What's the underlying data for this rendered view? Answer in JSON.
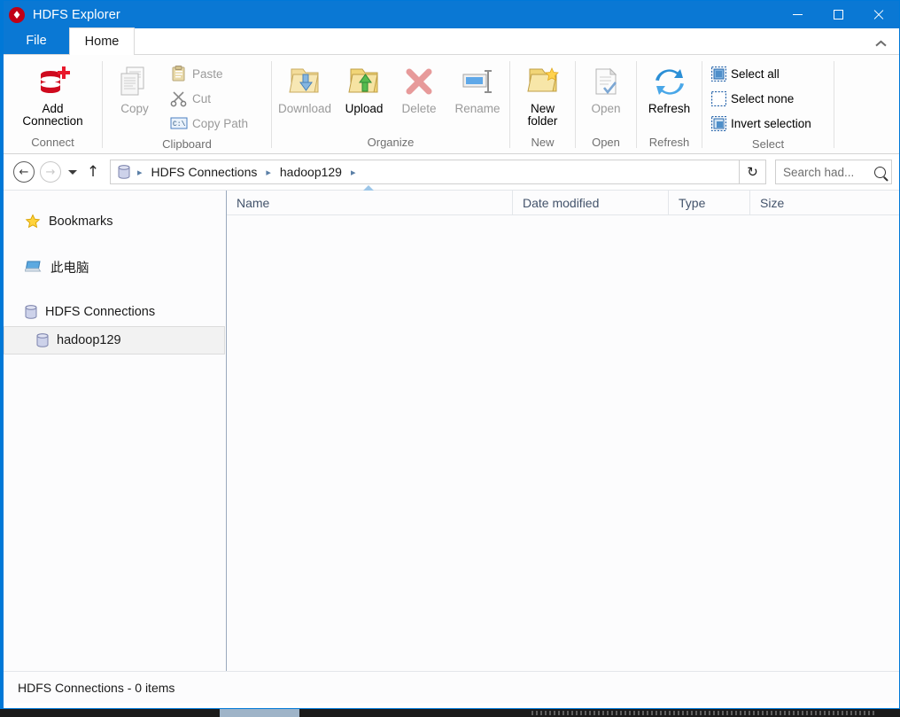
{
  "window": {
    "title": "HDFS Explorer",
    "app_icon": "hdfs-app-icon",
    "accent_color": "#0a78d4",
    "controls": {
      "minimize": "Minimize",
      "maximize": "Maximize",
      "close": "Close"
    }
  },
  "tabs": [
    {
      "label": "File",
      "id": "file",
      "active": false
    },
    {
      "label": "Home",
      "id": "home",
      "active": true
    }
  ],
  "ribbon": {
    "collapse_tooltip": "Minimize the Ribbon",
    "groups": [
      {
        "label": "Connect",
        "items": [
          {
            "label": "Add\nConnection",
            "label_line1": "Add",
            "label_line2": "Connection",
            "icon": "database-add-icon",
            "enabled": true,
            "size": "large"
          }
        ]
      },
      {
        "label": "Clipboard",
        "items": [
          {
            "label": "Copy",
            "icon": "copy-icon",
            "enabled": false,
            "size": "large"
          },
          {
            "label": "Paste",
            "icon": "paste-icon",
            "enabled": false,
            "size": "small"
          },
          {
            "label": "Cut",
            "icon": "scissors-icon",
            "enabled": false,
            "size": "small"
          },
          {
            "label": "Copy Path",
            "icon": "copy-path-icon",
            "enabled": false,
            "size": "small"
          }
        ]
      },
      {
        "label": "Organize",
        "items": [
          {
            "label": "Download",
            "icon": "folder-download-icon",
            "enabled": false,
            "size": "large"
          },
          {
            "label": "Upload",
            "icon": "folder-upload-icon",
            "enabled": true,
            "size": "large"
          },
          {
            "label": "Delete",
            "icon": "delete-x-icon",
            "enabled": false,
            "size": "large"
          },
          {
            "label": "Rename",
            "icon": "rename-icon",
            "enabled": false,
            "size": "large"
          }
        ]
      },
      {
        "label": "New",
        "items": [
          {
            "label_line1": "New",
            "label_line2": "folder",
            "icon": "new-folder-icon",
            "enabled": true,
            "size": "large"
          }
        ]
      },
      {
        "label": "Open",
        "items": [
          {
            "label": "Open",
            "icon": "open-file-icon",
            "enabled": false,
            "size": "large"
          }
        ]
      },
      {
        "label": "Refresh",
        "items": [
          {
            "label": "Refresh",
            "icon": "refresh-icon",
            "enabled": true,
            "size": "large"
          }
        ]
      },
      {
        "label": "Select",
        "items": [
          {
            "label": "Select all",
            "icon": "select-all-icon",
            "enabled": true,
            "size": "small"
          },
          {
            "label": "Select none",
            "icon": "select-none-icon",
            "enabled": true,
            "size": "small"
          },
          {
            "label": "Invert selection",
            "icon": "invert-selection-icon",
            "enabled": true,
            "size": "small"
          }
        ]
      }
    ]
  },
  "addressbar": {
    "back": {
      "icon": "back-arrow-icon",
      "glyph": "←",
      "enabled": true
    },
    "forward": {
      "icon": "forward-arrow-icon",
      "glyph": "→",
      "enabled": false
    },
    "history_dropdown": {
      "icon": "chevron-down-icon"
    },
    "up": {
      "icon": "up-arrow-icon",
      "glyph": "↑",
      "enabled": true
    },
    "location_icon": "database-icon",
    "breadcrumbs": [
      {
        "label": "HDFS Connections"
      },
      {
        "label": "hadoop129"
      }
    ],
    "separator": "▸",
    "refresh": {
      "icon": "refresh-arrow-icon",
      "glyph": "↻"
    },
    "search": {
      "placeholder": "Search had...",
      "value": "",
      "icon": "search-icon"
    }
  },
  "sidebar": {
    "items": [
      {
        "label": "Bookmarks",
        "icon": "star-icon",
        "selected": false,
        "level": 0
      },
      {
        "label": "此电脑",
        "icon": "this-pc-icon",
        "selected": false,
        "level": 0
      },
      {
        "label": "HDFS Connections",
        "icon": "database-icon",
        "selected": false,
        "level": 0
      },
      {
        "label": "hadoop129",
        "icon": "database-icon",
        "selected": true,
        "level": 1
      }
    ]
  },
  "filelist": {
    "columns": [
      {
        "label": "Name",
        "sorted": true,
        "sort_dir": "asc"
      },
      {
        "label": "Date modified",
        "sorted": false
      },
      {
        "label": "Type",
        "sorted": false
      },
      {
        "label": "Size",
        "sorted": false
      }
    ],
    "rows": []
  },
  "statusbar": {
    "text": "HDFS Connections - 0 items"
  }
}
